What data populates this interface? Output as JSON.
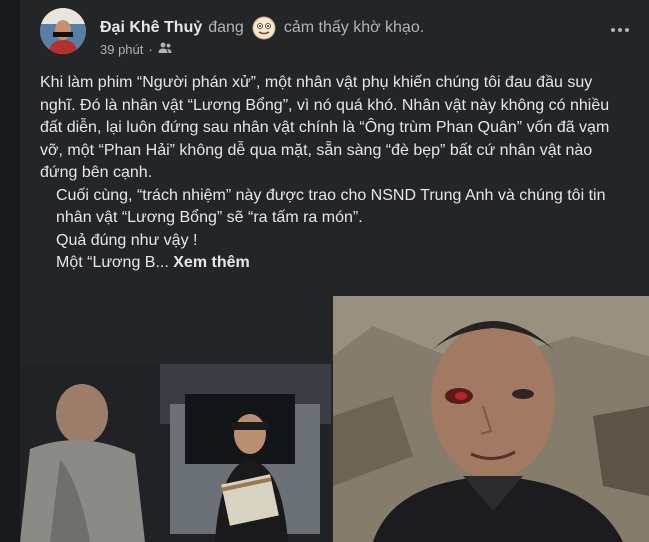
{
  "post": {
    "author": "Đại Khê Thuỷ",
    "status_prefix": "đang",
    "feeling": "cảm thấy khờ khạo.",
    "time": "39 phút",
    "dot": "·",
    "paragraphs": [
      "Khi làm phim “Người phán xử”, một nhân vật phụ khiến chúng tôi đau đầu suy nghĩ. Đó là nhân vật “Lương Bổng”, vì nó quá khó. Nhân vật này không có nhiều đất diễn, lại luôn đứng sau nhân vật chính là “Ông trùm Phan Quân” vốn đã vạm vỡ, một “Phan Hải” không dễ qua mặt, sẵn sàng “đè bẹp” bất cứ nhân vật nào đứng bên cạnh.",
      "Cuối cùng, “trách nhiệm” này được trao cho NSND Trung Anh và chúng tôi tin nhân vật “Lương Bổng” sẽ “ra tấm ra món”.",
      "Quả đúng như vậy !"
    ],
    "truncated": "Một “Lương B...",
    "see_more": "Xem thêm"
  },
  "icons": {
    "feeling": "dizzy-face-emoji",
    "audience": "friends-icon",
    "more": "more-options-icon"
  },
  "colors": {
    "card_bg": "#242526",
    "text_primary": "#e4e6eb",
    "text_secondary": "#b0b3b8"
  }
}
